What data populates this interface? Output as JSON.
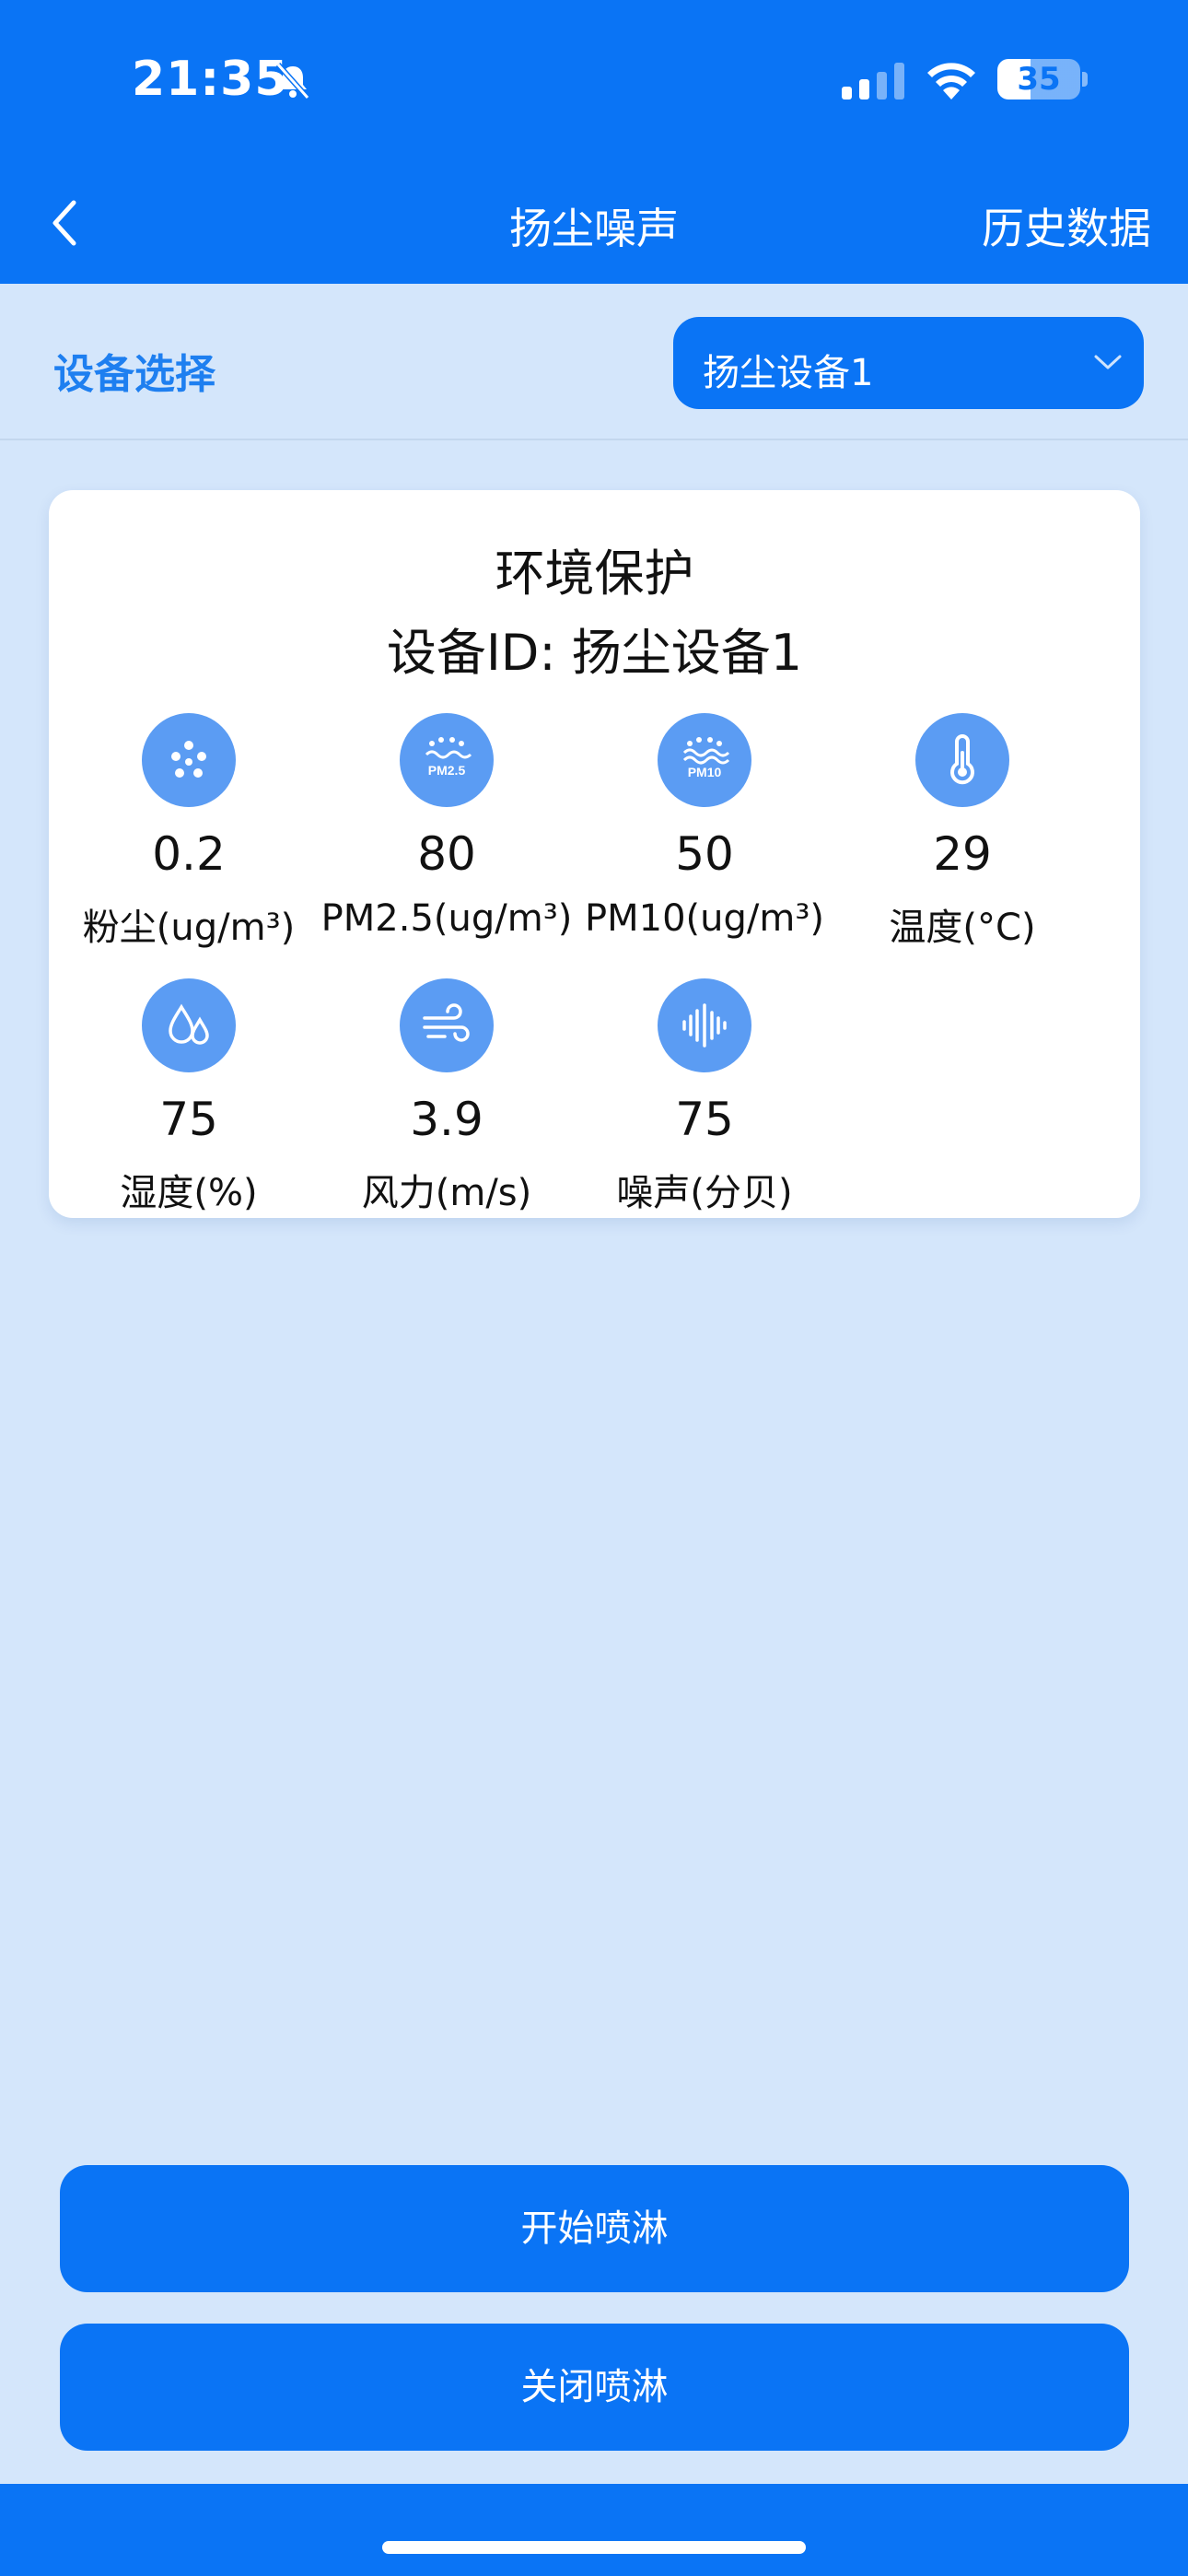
{
  "status_bar": {
    "time": "21:35",
    "battery": "35"
  },
  "nav": {
    "title": "扬尘噪声",
    "right_action": "历史数据"
  },
  "selector": {
    "label": "设备选择",
    "value": "扬尘设备1"
  },
  "card": {
    "title": "环境保护",
    "device_line": "设备ID: 扬尘设备1",
    "metrics": [
      {
        "icon": "dust-icon",
        "value": "0.2",
        "label": "粉尘(ug/m³)"
      },
      {
        "icon": "pm25-icon",
        "value": "80",
        "label": "PM2.5(ug/m³)"
      },
      {
        "icon": "pm10-icon",
        "value": "50",
        "label": "PM10(ug/m³)"
      },
      {
        "icon": "thermometer-icon",
        "value": "29",
        "label": "温度(°C)"
      },
      {
        "icon": "humidity-icon",
        "value": "75",
        "label": "湿度(%)"
      },
      {
        "icon": "wind-icon",
        "value": "3.9",
        "label": "风力(m/s)"
      },
      {
        "icon": "sound-wave-icon",
        "value": "75",
        "label": "噪声(分贝)"
      }
    ],
    "icon_badges": {
      "pm25": "PM2.5",
      "pm10": "PM10"
    }
  },
  "actions": {
    "start_label": "开始喷淋",
    "stop_label": "关闭喷淋"
  },
  "colors": {
    "primary": "#0a74f5",
    "background": "#d4e6fb",
    "icon_circle": "#5b9cf3"
  }
}
